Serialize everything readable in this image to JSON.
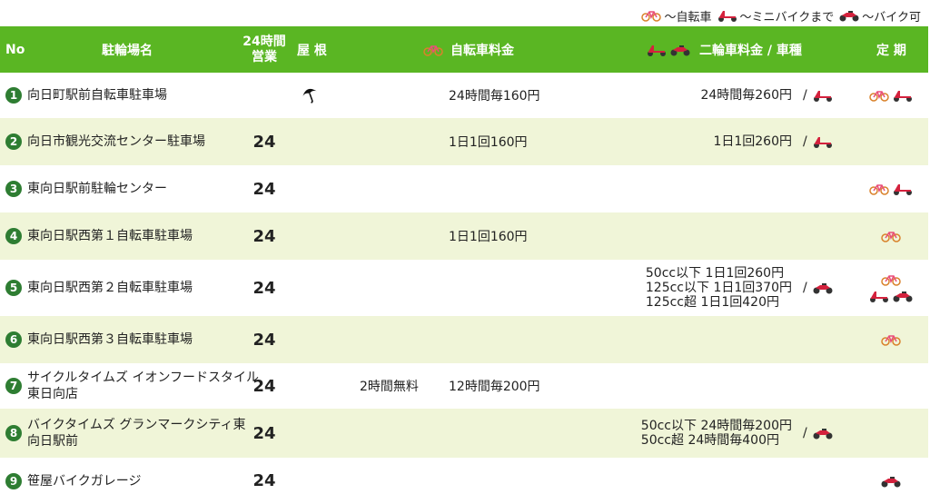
{
  "legend": {
    "bicycle_label": "～自転車",
    "minibike_label": "～ミニバイクまで",
    "motorbike_label": "～バイク可"
  },
  "header": {
    "no": "No",
    "name": "駐輪場名",
    "open24": "24時間\n営業",
    "roof": "屋 根",
    "bike_fee": "自転車料金",
    "moto_fee": "二輪車料金 / 車種",
    "subscription": "定 期"
  },
  "rows": [
    {
      "no": "1",
      "name": "向日町駅前自転車駐車場",
      "open24": "",
      "roof": true,
      "free": "",
      "bike_fee": "24時間毎160円",
      "moto_fee": "24時間毎260円",
      "type_icon": "minibike-icon",
      "sub": [
        [
          "bicycle-icon",
          "minibike-icon"
        ]
      ]
    },
    {
      "no": "2",
      "name": "向日市観光交流センター駐車場",
      "open24": "24",
      "roof": false,
      "free": "",
      "bike_fee": "1日1回160円",
      "moto_fee": "1日1回260円",
      "type_icon": "minibike-icon",
      "sub": []
    },
    {
      "no": "3",
      "name": "東向日駅前駐輪センター",
      "open24": "24",
      "roof": false,
      "free": "",
      "bike_fee": "",
      "moto_fee": "",
      "type_icon": "",
      "sub": [
        [
          "bicycle-icon",
          "minibike-icon"
        ]
      ]
    },
    {
      "no": "4",
      "name": "東向日駅西第１自転車駐車場",
      "open24": "24",
      "roof": false,
      "free": "",
      "bike_fee": "1日1回160円",
      "moto_fee": "",
      "type_icon": "",
      "sub": [
        [
          "bicycle-icon"
        ]
      ]
    },
    {
      "no": "5",
      "name": "東向日駅西第２自転車駐車場",
      "open24": "24",
      "roof": false,
      "free": "",
      "bike_fee": "",
      "moto_fee": "50cc以下 1日1回260円\n125cc以下 1日1回370円\n125cc超 1日1回420円",
      "type_icon": "motorbike-icon",
      "sub": [
        [
          "bicycle-icon"
        ],
        [
          "minibike-icon",
          "motorbike-icon"
        ]
      ]
    },
    {
      "no": "6",
      "name": "東向日駅西第３自転車駐車場",
      "open24": "24",
      "roof": false,
      "free": "",
      "bike_fee": "",
      "moto_fee": "",
      "type_icon": "",
      "sub": [
        [
          "bicycle-icon"
        ]
      ]
    },
    {
      "no": "7",
      "name": "サイクルタイムズ イオンフードスタイル\n東日向店",
      "open24": "24",
      "roof": false,
      "free": "2時間無料",
      "bike_fee": "12時間毎200円",
      "moto_fee": "",
      "type_icon": "",
      "sub": []
    },
    {
      "no": "8",
      "name": "バイクタイムズ グランマークシティ東\n向日駅前",
      "open24": "24",
      "roof": false,
      "free": "",
      "bike_fee": "",
      "moto_fee": "50cc以下 24時間毎200円\n50cc超 24時間毎400円",
      "type_icon": "motorbike-icon",
      "sub": []
    },
    {
      "no": "9",
      "name": "笹屋バイクガレージ",
      "open24": "24",
      "roof": false,
      "free": "",
      "bike_fee": "",
      "moto_fee": "",
      "type_icon": "",
      "sub": [
        [
          "motorbike-icon"
        ]
      ]
    }
  ],
  "colors": {
    "header_bg": "#5ab623",
    "alt_row_bg": "#f0f5d8",
    "number_badge": "#2e7d32"
  }
}
